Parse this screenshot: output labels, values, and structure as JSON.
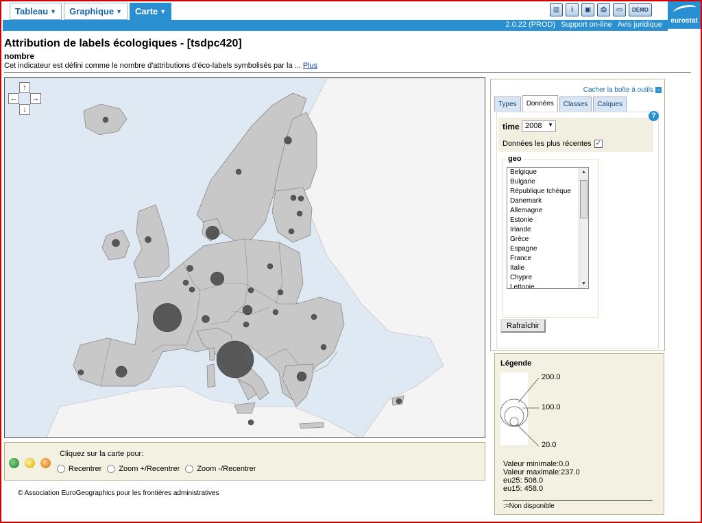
{
  "nav": {
    "tabs": [
      {
        "label": "Tableau"
      },
      {
        "label": "Graphique"
      },
      {
        "label": "Carte"
      }
    ],
    "toolbar_icons": [
      "mdb-icon",
      "info-icon",
      "save-icon",
      "print-icon",
      "folder-icon"
    ],
    "demo_label": "DEMO",
    "version": "2.0.22 (PROD)",
    "support_link": "Support on-line",
    "legal_link": "Avis juridique",
    "logo_text": "eurostat"
  },
  "header": {
    "title": "Attribution de labels écologiques - [tsdpc420]",
    "subtitle": "nombre",
    "description": "Cet indicateur est défini comme le nombre d'attributions d'éco-labels symbolisés par la ...",
    "more_link": "Plus"
  },
  "map": {
    "pan_arrows": {
      "up": "↑",
      "down": "↓",
      "left": "←",
      "right": "→"
    },
    "land_color": "#c8c8c8",
    "sea_color": "#dfe9f3",
    "symbol_color": "#4a4a4a",
    "max_value": 237,
    "symbols": [
      {
        "country": "Iceland",
        "value": 4
      },
      {
        "country": "Norway",
        "value": 4
      },
      {
        "country": "Sweden",
        "value": 10
      },
      {
        "country": "Finland",
        "value": 4
      },
      {
        "country": "Ireland",
        "value": 10
      },
      {
        "country": "United Kingdom",
        "value": 7
      },
      {
        "country": "Denmark",
        "value": 31
      },
      {
        "country": "Estonia",
        "value": 4
      },
      {
        "country": "Latvia",
        "value": 4
      },
      {
        "country": "Lithuania",
        "value": 4
      },
      {
        "country": "Netherlands",
        "value": 7
      },
      {
        "country": "Belgium",
        "value": 4
      },
      {
        "country": "Luxembourg",
        "value": 1
      },
      {
        "country": "Germany",
        "value": 31
      },
      {
        "country": "Poland",
        "value": 4
      },
      {
        "country": "France",
        "value": 140
      },
      {
        "country": "Czech Republic",
        "value": 4
      },
      {
        "country": "Slovakia",
        "value": 1
      },
      {
        "country": "Austria",
        "value": 16
      },
      {
        "country": "Hungary",
        "value": 4
      },
      {
        "country": "Switzerland",
        "value": 10
      },
      {
        "country": "Slovenia",
        "value": 4
      },
      {
        "country": "Romania",
        "value": 4
      },
      {
        "country": "Bulgaria",
        "value": 1
      },
      {
        "country": "Portugal",
        "value": 4
      },
      {
        "country": "Spain",
        "value": 22
      },
      {
        "country": "Italy",
        "value": 237
      },
      {
        "country": "Greece",
        "value": 16
      },
      {
        "country": "Cyprus",
        "value": 4
      },
      {
        "country": "Malta",
        "value": 1
      }
    ]
  },
  "map_controls": {
    "instruction": "Cliquez sur la carte pour:",
    "options": [
      "Recentrer",
      "Zoom +/Recentrer",
      "Zoom -/Recentrer"
    ]
  },
  "copyright": "© Association EuroGeographics pour les frontières administratives",
  "toolbox": {
    "hide_label": "Cacher la boîte à outils",
    "tabs": [
      "Types",
      "Données",
      "Classes",
      "Calques"
    ],
    "active_tab": "Données",
    "help": "?",
    "time_label": "time",
    "time_value": "2008",
    "recent_label": "Données les plus récentes",
    "recent_checked": "✓",
    "geo_label": "geo",
    "geo_items": [
      "Belgique",
      "Bulgarie",
      "République tchèque",
      "Danemark",
      "Allemagne",
      "Estonie",
      "Irlande",
      "Grèce",
      "Espagne",
      "France",
      "Italie",
      "Chypre",
      "Lettonie"
    ],
    "refresh_label": "Rafraîchir"
  },
  "legend": {
    "title": "Légende",
    "values": [
      "200.0",
      "100.0",
      "20.0"
    ],
    "min_label": "Valeur minimale:0.0",
    "max_label": "Valeur maximale:237.0",
    "eu25_label": "eu25: 508.0",
    "eu15_label": "eu15: 458.0",
    "na_label": ":=Non disponible"
  }
}
